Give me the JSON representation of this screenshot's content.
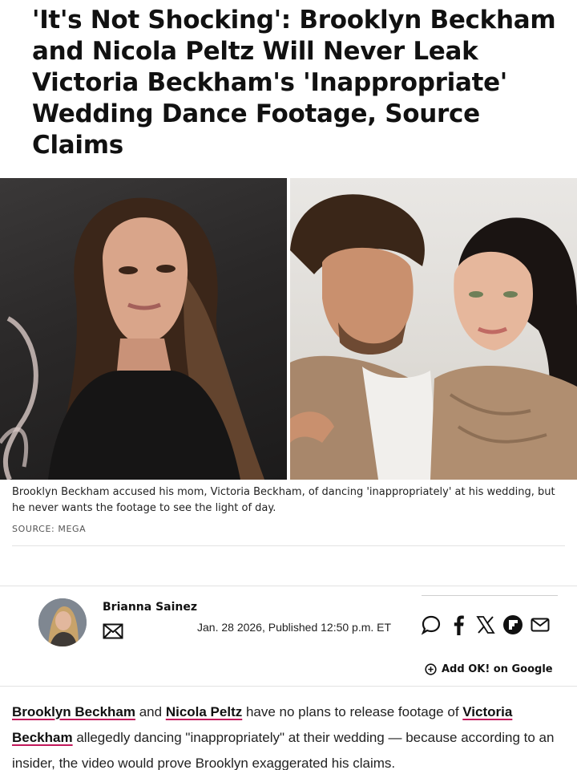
{
  "article": {
    "headline": "'It's Not Shocking': Brooklyn Beckham and Nicola Peltz Will Never Leak Victoria Beckham's 'Inappropriate' Wedding Dance Footage, Source Claims",
    "caption": "Brooklyn Beckham accused his mom, Victoria Beckham, of dancing 'inappropriately' at his wedding, but he never wants the footage to see the light of day.",
    "source": "SOURCE: MEGA"
  },
  "author": {
    "name": "Brianna Sainez",
    "date": "Jan. 28 2026, Published 12:50 p.m. ET"
  },
  "share": {
    "icons": [
      "comment-icon",
      "facebook-icon",
      "x-icon",
      "flipboard-icon",
      "mail-icon"
    ]
  },
  "follow": {
    "label": "Add OK! on Google"
  },
  "body": {
    "link1": "Brooklyn Beckham",
    "text1": " and ",
    "link2": "Nicola Peltz",
    "text2": " have no plans to release footage of ",
    "link3": "Victoria Beckham",
    "text3": " allegedly dancing \"inappropriately\" at their wedding — because according to an insider, the video would prove Brooklyn exaggerated his claims."
  },
  "colors": {
    "link_underline": "#c2185b",
    "text": "#111111"
  }
}
